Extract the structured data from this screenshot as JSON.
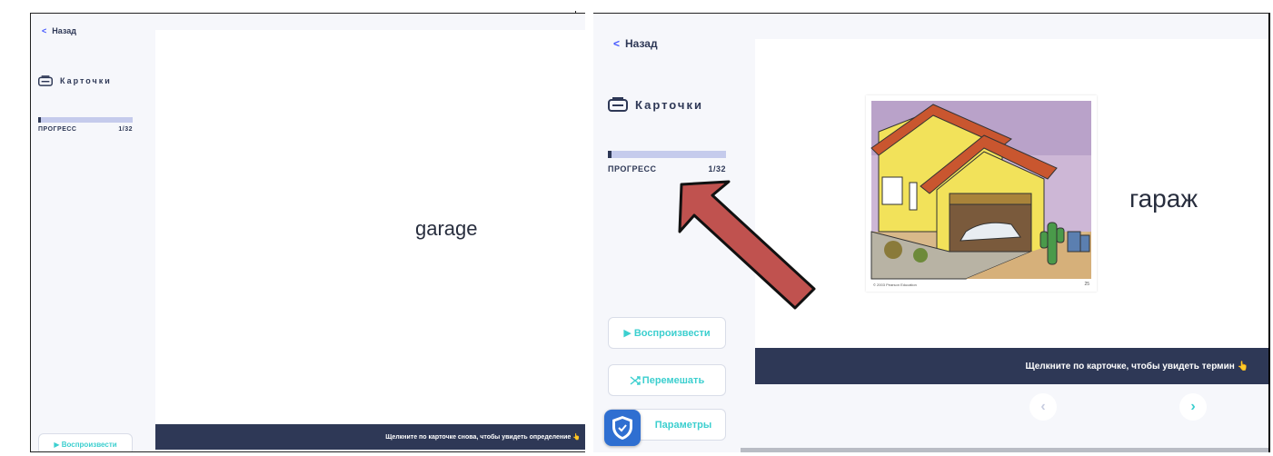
{
  "left_panel": {
    "back_label": "Назад",
    "mode_title": "Карточки",
    "progress_label": "ПРОГРЕСС",
    "progress_count": "1/32",
    "progress_fraction": 0.03125,
    "term": "garage",
    "play_label": "▶ Воспроизвести",
    "hint": "Щелкните по карточке снова, чтобы увидеть определение 👆"
  },
  "right_panel": {
    "back_label": "Назад",
    "mode_title": "Карточки",
    "progress_label": "ПРОГРЕСС",
    "progress_count": "1/32",
    "progress_fraction": 0.03125,
    "term": "гараж",
    "image_credit": "© 2003 Pearson Education",
    "image_page": "25",
    "play_label": "▶ Воспроизвести",
    "shuffle_label": "Перемешать",
    "options_label": "Параметры",
    "hint": "Щелкните по карточке, чтобы увидеть термин 👆",
    "prev_icon": "‹",
    "next_icon": "›"
  },
  "colors": {
    "navy": "#2e3856",
    "accent": "#3ccfcf",
    "progress_track": "#c5cbec",
    "arrow": "#c0524f",
    "shield": "#2f6fd1"
  }
}
